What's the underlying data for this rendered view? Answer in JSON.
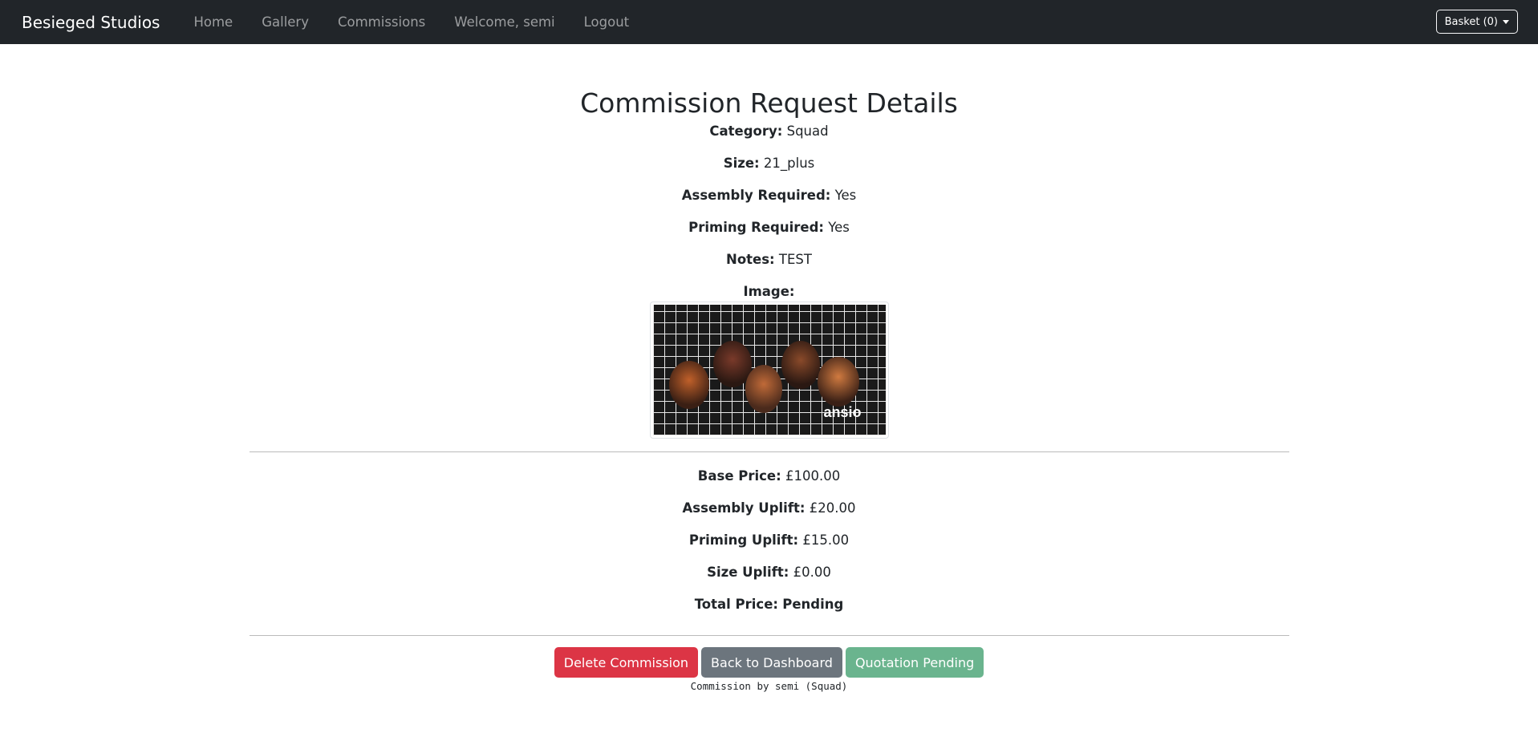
{
  "navbar": {
    "brand": "Besieged Studios",
    "links": [
      "Home",
      "Gallery",
      "Commissions",
      "Welcome, semi",
      "Logout"
    ],
    "basket_label": "Basket (0)"
  },
  "page": {
    "title": "Commission Request Details",
    "details": [
      {
        "label": "Category:",
        "value": "Squad"
      },
      {
        "label": "Size:",
        "value": "21_plus"
      },
      {
        "label": "Assembly Required:",
        "value": "Yes"
      },
      {
        "label": "Priming Required:",
        "value": "Yes"
      },
      {
        "label": "Notes:",
        "value": "TEST"
      }
    ],
    "image_label": "Image:",
    "image_watermark": "ansio",
    "pricing": [
      {
        "label": "Base Price:",
        "value": "£100.00"
      },
      {
        "label": "Assembly Uplift:",
        "value": "£20.00"
      },
      {
        "label": "Priming Uplift:",
        "value": "£15.00"
      },
      {
        "label": "Size Uplift:",
        "value": "£0.00"
      }
    ],
    "total_label": "Total Price:",
    "total_value": "Pending",
    "buttons": {
      "delete": "Delete Commission",
      "back": "Back to Dashboard",
      "quotation": "Quotation Pending"
    },
    "footer_note": "Commission by semi (Squad)"
  },
  "colors": {
    "navbar_bg": "#212529",
    "danger": "#dc3545",
    "secondary": "#6c757d",
    "success": "#6ab48e"
  }
}
